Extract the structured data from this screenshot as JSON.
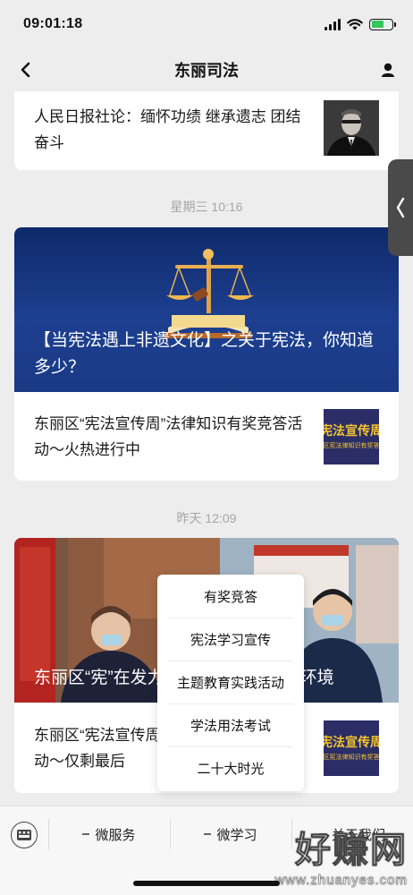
{
  "status": {
    "time": "09:01:18"
  },
  "nav": {
    "title": "东丽司法"
  },
  "feed": {
    "card1": {
      "text": "人民日报社论：缅怀功绩 继承遗志 团结奋斗"
    },
    "group2": {
      "time": "星期三 10:16",
      "hero_title": "【当宪法遇上非遗文化】之关于宪法，你知道多少？",
      "item_text": "东丽区“宪法宣传周”法律知识有奖竞答活动～火热进行中",
      "thumb_line1": "宪法宣传周",
      "thumb_line2": "区宪法律知识有奖答"
    },
    "group3": {
      "time": "昨天 12:09",
      "hero_title": "东丽区“宪”在发力法治护航优化营商环境",
      "item_text": "东丽区“宪法宣传周”法律知识有奖竞答活动～仅剩最后",
      "thumb_line1": "宪法宣传周",
      "thumb_line2": "区宪法律知识有奖答"
    }
  },
  "popup_menu": {
    "items": [
      {
        "label": "有奖竞答"
      },
      {
        "label": "宪法学习宣传"
      },
      {
        "label": "主题教育实践活动"
      },
      {
        "label": "学法用法考试"
      },
      {
        "label": "二十大时光"
      }
    ]
  },
  "tab_bar": {
    "menus": [
      {
        "label": "微服务"
      },
      {
        "label": "微学习"
      },
      {
        "label": "关于我们"
      }
    ]
  },
  "watermark": {
    "main": "好赚网",
    "sub": "www.zhuanyes.com"
  },
  "colors": {
    "background": "#ededed",
    "card": "#ffffff",
    "timestamp": "#a6a6a6",
    "hero_blue": "#1d3f8f",
    "thumb_navy": "#2b2e66",
    "thumb_yellow": "#f4c430"
  }
}
